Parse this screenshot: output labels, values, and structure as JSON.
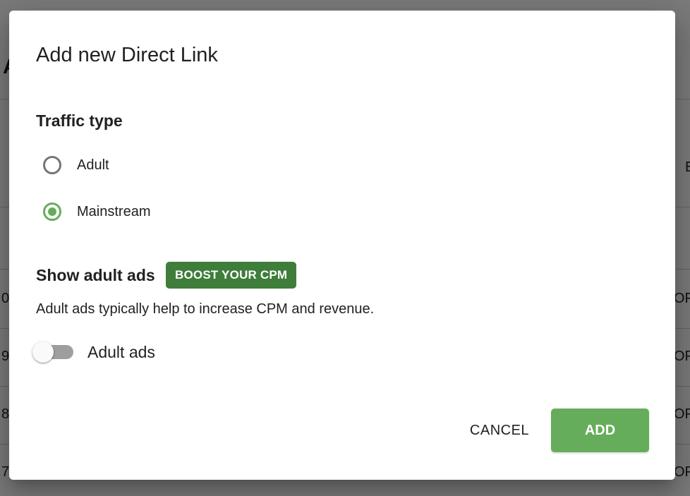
{
  "background": {
    "fragments": [
      "A",
      "E",
      "0",
      "OP",
      "9",
      "OP",
      "8",
      "OP",
      "7",
      "OP"
    ]
  },
  "dialog": {
    "title": "Add new Direct Link",
    "traffic_type": {
      "label": "Traffic type",
      "options": [
        {
          "label": "Adult",
          "checked": false
        },
        {
          "label": "Mainstream",
          "checked": true
        }
      ]
    },
    "adult_ads": {
      "label": "Show adult ads",
      "badge": "BOOST YOUR CPM",
      "description": "Adult ads typically help to increase CPM and revenue.",
      "toggle_label": "Adult ads",
      "toggle_on": false
    },
    "actions": {
      "cancel_label": "CANCEL",
      "add_label": "ADD"
    }
  },
  "colors": {
    "accent_green": "#66ad5b",
    "badge_green": "#3f7d3a",
    "text": "#212121"
  }
}
